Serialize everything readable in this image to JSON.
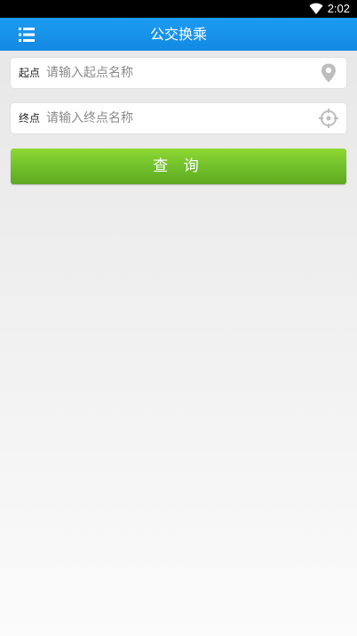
{
  "status_bar": {
    "time": "2:02",
    "wifi_icon": "wifi-icon"
  },
  "app_bar": {
    "title": "公交换乘",
    "menu_icon": "list-menu-icon",
    "color": "#1890e8"
  },
  "form": {
    "start": {
      "label": "起点",
      "placeholder": "请输入起点名称",
      "value": "",
      "icon": "location-pin-icon"
    },
    "end": {
      "label": "终点",
      "placeholder": "请输入终点名称",
      "value": "",
      "icon": "locate-crosshair-icon"
    },
    "query_button": {
      "label": "查 询",
      "color": "#72c12c"
    }
  }
}
